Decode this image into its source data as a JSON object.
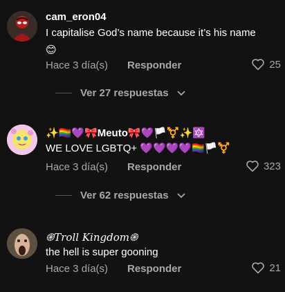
{
  "comments": [
    {
      "username": "cam_eron04",
      "text": "I capitalise God’s name because it’s his name",
      "emoji": "😊",
      "time": "Hace 3 día(s)",
      "reply_label": "Responder",
      "likes": "25",
      "replies_label": "Ver 27 respuestas"
    },
    {
      "username_prefix": "✨🏳️‍🌈💜🎀",
      "username": "Meuto",
      "username_suffix": "🎀💜🏳️⚧️✨🔯",
      "text": "WE LOVE LGBTQ+",
      "text_suffix": "💜💜💜💜🏳️‍🌈🏳️⚧️",
      "time": "Hace 3 día(s)",
      "reply_label": "Responder",
      "likes": "323",
      "replies_label": "Ver 62 respuestas"
    },
    {
      "username": "֎𝑇𝑟𝑜𝑙𝑙 𝐾𝑖𝑛𝑔𝑑𝑜𝑚֎",
      "text": "the hell is super gooning",
      "time": "Hace 3 día(s)",
      "reply_label": "Responder",
      "likes": "21"
    }
  ],
  "icons": {
    "like": "heart-outline-icon",
    "chevron": "chevron-down-icon"
  },
  "colors": {
    "background": "#121212",
    "primary_text": "#ffffff",
    "secondary_text": "#a8a8a8",
    "heart_purple": "#a070f0"
  }
}
